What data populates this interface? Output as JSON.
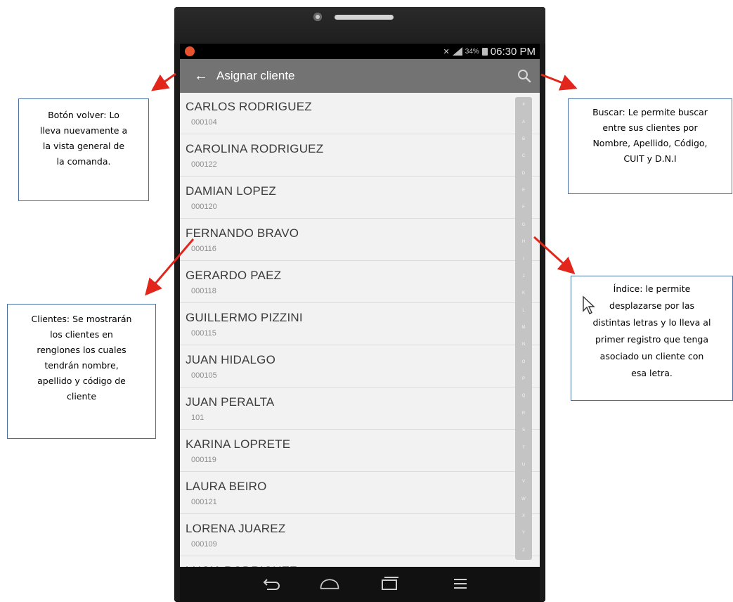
{
  "status_bar": {
    "battery": "34%",
    "time": "06:30 PM"
  },
  "toolbar": {
    "title": "Asignar cliente",
    "back_icon": "arrow-left-icon",
    "search_icon": "search-icon"
  },
  "clients": [
    {
      "name": "CARLOS RODRIGUEZ",
      "code": "000104"
    },
    {
      "name": "CAROLINA RODRIGUEZ",
      "code": "000122"
    },
    {
      "name": "DAMIAN LOPEZ",
      "code": "000120"
    },
    {
      "name": "FERNANDO BRAVO",
      "code": "000116"
    },
    {
      "name": "GERARDO PAEZ",
      "code": "000118"
    },
    {
      "name": "GUILLERMO PIZZINI",
      "code": "000115"
    },
    {
      "name": "JUAN HIDALGO",
      "code": "000105"
    },
    {
      "name": "JUAN PERALTA",
      "code": "101"
    },
    {
      "name": "KARINA LOPRETE",
      "code": "000119"
    },
    {
      "name": "LAURA BEIRO",
      "code": "000121"
    },
    {
      "name": "LORENA JUAREZ",
      "code": "000109"
    },
    {
      "name": "LUCIA RODRIGUEZ",
      "code": ""
    }
  ],
  "index_letters": [
    "#",
    "A",
    "B",
    "C",
    "D",
    "E",
    "F",
    "G",
    "H",
    "I",
    "J",
    "K",
    "L",
    "M",
    "N",
    "O",
    "P",
    "Q",
    "R",
    "S",
    "T",
    "U",
    "V",
    "W",
    "X",
    "Y",
    "Z"
  ],
  "annotations": {
    "back": [
      "Botón volver:  Lo",
      "lleva nuevamente a",
      "la vista general de",
      "la comanda."
    ],
    "search": [
      "Buscar: Le permite buscar",
      "entre sus clientes por",
      "Nombre, Apellido, Código,",
      "CUIT y D.N.I"
    ],
    "clients": [
      "Clientes: Se mostrarán",
      "los clientes en",
      "renglones los cuales",
      "tendrán nombre,",
      "apellido y código de",
      "cliente"
    ],
    "index": [
      "Índice: le permite",
      "desplazarse por las",
      "distintas letras y lo lleva al",
      "primer registro que tenga",
      "asociado un cliente con",
      "esa letra."
    ]
  },
  "colors": {
    "toolbar": "#737373",
    "arrow": "#e2261c",
    "note_border": "#4a6fa5"
  }
}
